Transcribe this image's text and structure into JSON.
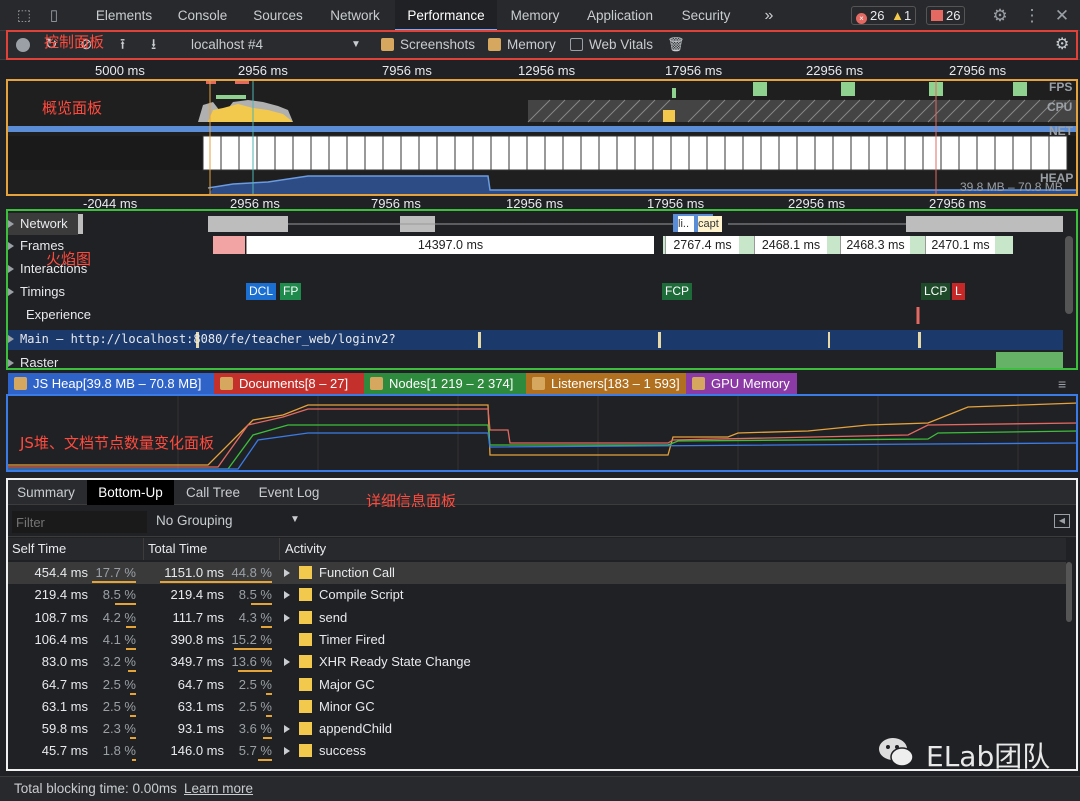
{
  "tabbar": {
    "tabs": [
      "Elements",
      "Console",
      "Sources",
      "Network",
      "Performance",
      "Memory",
      "Application",
      "Security"
    ],
    "more": "»",
    "errors": "26",
    "warnings": "1",
    "issues": "26"
  },
  "controls": {
    "profile_select": "localhost #4",
    "screenshots_label": "Screenshots",
    "memory_label": "Memory",
    "webvitals_label": "Web Vitals"
  },
  "annotations": {
    "control_panel": "控制面板",
    "overview_panel": "概览面板",
    "flame_chart": "火焰图",
    "counters_panel": "JS堆、文档节点数量变化面板",
    "details_panel": "详细信息面板"
  },
  "overview": {
    "ticks": [
      "5000 ms",
      "2956 ms",
      "7956 ms",
      "12956 ms",
      "17956 ms",
      "22956 ms",
      "27956 ms"
    ],
    "labels": {
      "fps": "FPS",
      "cpu": "CPU",
      "net": "NET",
      "heap": "HEAP"
    },
    "heap_range": "39.8 MB – 70.8 MB"
  },
  "flame": {
    "ticks": [
      "-2044 ms",
      "2956 ms",
      "7956 ms",
      "12956 ms",
      "17956 ms",
      "22956 ms",
      "27956 ms"
    ],
    "tracks": {
      "network": "Network",
      "frames": "Frames",
      "interactions": "Interactions",
      "timings": "Timings",
      "experience": "Experience",
      "main": "Main — http://localhost:8080/fe/teacher_web/loginv2?",
      "raster": "Raster"
    },
    "network_items": [
      "li..",
      "capt"
    ],
    "frames": [
      "14397.0 ms",
      "2767.4 ms",
      "2468.1 ms",
      "2468.3 ms",
      "2470.1 ms"
    ],
    "timing_marks": {
      "dcl": "DCL",
      "fp": "FP",
      "fcp": "FCP",
      "lcp": "LCP",
      "l": "L"
    }
  },
  "counters": {
    "js_heap": "JS Heap[39.8 MB – 70.8 MB]",
    "documents": "Documents[8 – 27]",
    "nodes": "Nodes[1 219 – 2 374]",
    "listeners": "Listeners[183 – 1 593]",
    "gpu": "GPU Memory",
    "colors": {
      "js_heap": "#2f63c8",
      "documents": "#c4302b",
      "nodes": "#2e8a3c",
      "listeners": "#b0701f",
      "gpu": "#8c3aa6"
    }
  },
  "details": {
    "tabs": [
      "Summary",
      "Bottom-Up",
      "Call Tree",
      "Event Log"
    ],
    "filter_placeholder": "Filter",
    "grouping": "No Grouping",
    "columns": {
      "self": "Self Time",
      "total": "Total Time",
      "activity": "Activity"
    },
    "rows": [
      {
        "self": "454.4 ms",
        "self_pct": "17.7 %",
        "total": "1151.0 ms",
        "total_pct": "44.8 %",
        "activity": "Function Call",
        "expand": true
      },
      {
        "self": "219.4 ms",
        "self_pct": "8.5 %",
        "total": "219.4 ms",
        "total_pct": "8.5 %",
        "activity": "Compile Script",
        "expand": true
      },
      {
        "self": "108.7 ms",
        "self_pct": "4.2 %",
        "total": "111.7 ms",
        "total_pct": "4.3 %",
        "activity": "send",
        "expand": true
      },
      {
        "self": "106.4 ms",
        "self_pct": "4.1 %",
        "total": "390.8 ms",
        "total_pct": "15.2 %",
        "activity": "Timer Fired",
        "expand": false
      },
      {
        "self": "83.0 ms",
        "self_pct": "3.2 %",
        "total": "349.7 ms",
        "total_pct": "13.6 %",
        "activity": "XHR Ready State Change",
        "expand": true
      },
      {
        "self": "64.7 ms",
        "self_pct": "2.5 %",
        "total": "64.7 ms",
        "total_pct": "2.5 %",
        "activity": "Major GC",
        "expand": false
      },
      {
        "self": "63.1 ms",
        "self_pct": "2.5 %",
        "total": "63.1 ms",
        "total_pct": "2.5 %",
        "activity": "Minor GC",
        "expand": false
      },
      {
        "self": "59.8 ms",
        "self_pct": "2.3 %",
        "total": "93.1 ms",
        "total_pct": "3.6 %",
        "activity": "appendChild",
        "expand": true
      },
      {
        "self": "45.7 ms",
        "self_pct": "1.8 %",
        "total": "146.0 ms",
        "total_pct": "5.7 %",
        "activity": "success",
        "expand": true
      }
    ]
  },
  "footer": {
    "tbt": "Total blocking time: 0.00ms",
    "learn_more": "Learn more"
  },
  "watermark": "ELab团队"
}
